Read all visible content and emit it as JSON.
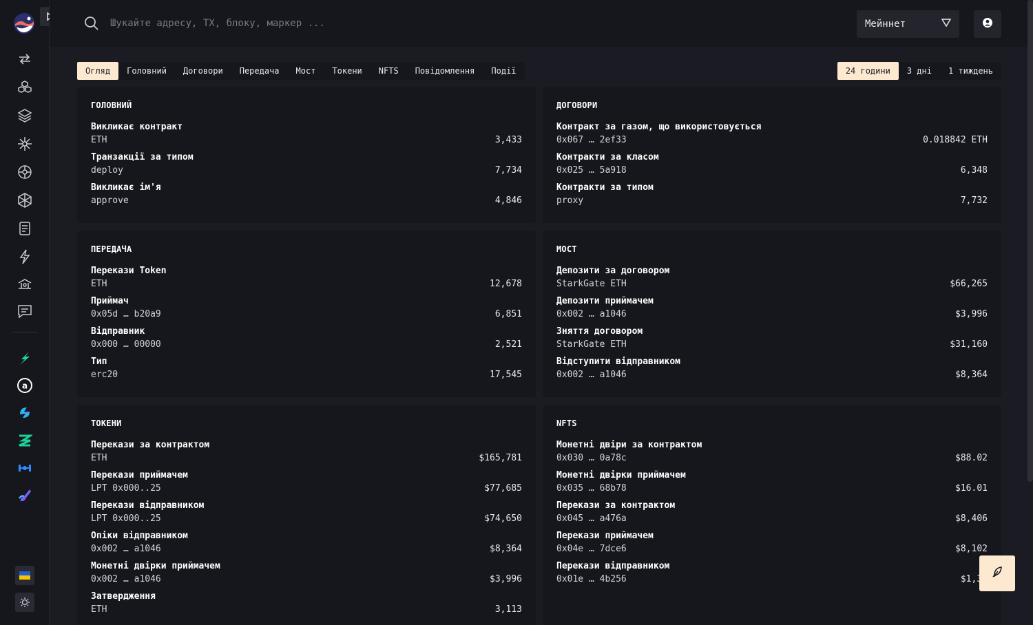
{
  "header": {
    "search_placeholder": "Шукайте адресу, TX, блоку, маркер ...",
    "network": "Мейннет"
  },
  "tabs": [
    "Огляд",
    "Головний",
    "Договори",
    "Передача",
    "Мост",
    "Токени",
    "NFTS",
    "Повідомлення",
    "Події"
  ],
  "periods": [
    "24 години",
    "3 дні",
    "1 тиждень"
  ],
  "sidebar": {
    "nav_icons": [
      "transactions-icon",
      "blocks-icon",
      "batches-icon",
      "sparkle-icon",
      "contracts-icon",
      "network-icon",
      "document-icon",
      "lightning-icon",
      "bridge-icon",
      "message-icon"
    ],
    "app_icons": [
      "starkgate-icon",
      "argent-icon",
      "layerswap-icon",
      "zksync-icon",
      "orbiter-icon",
      "jediswap-icon"
    ]
  },
  "cards": {
    "main": {
      "title": "ГОЛОВНИЙ",
      "rows": [
        {
          "label": "Викликає контракт",
          "sub": "ETH",
          "value": "3,433"
        },
        {
          "label": "Транзакції за типом",
          "sub": "deploy",
          "value": "7,734"
        },
        {
          "label": "Викликає ім'я",
          "sub": "approve",
          "value": "4,846"
        }
      ]
    },
    "contracts": {
      "title": "ДОГОВОРИ",
      "rows": [
        {
          "label": "Контракт за газом, що використовується",
          "sub": "0x067 … 2ef33",
          "value": "0.018842 ETH"
        },
        {
          "label": "Контракти за класом",
          "sub": "0x025 … 5a918",
          "value": "6,348"
        },
        {
          "label": "Контракти за типом",
          "sub": "proxy",
          "value": "7,732"
        }
      ]
    },
    "transfer": {
      "title": "ПЕРЕДАЧА",
      "rows": [
        {
          "label": "Перекази Token",
          "sub": "ETH",
          "value": "12,678"
        },
        {
          "label": "Приймач",
          "sub": "0x05d … b20a9",
          "value": "6,851"
        },
        {
          "label": "Відправник",
          "sub": "0x000 … 00000",
          "value": "2,521"
        },
        {
          "label": "Тип",
          "sub": "erc20",
          "value": "17,545"
        }
      ]
    },
    "bridge": {
      "title": "МОСТ",
      "rows": [
        {
          "label": "Депозити за договором",
          "sub": "StarkGate ETH",
          "value": "$66,265"
        },
        {
          "label": "Депозити приймачем",
          "sub": "0x002 … a1046",
          "value": "$3,996"
        },
        {
          "label": "Зняття договором",
          "sub": "StarkGate ETH",
          "value": "$31,160"
        },
        {
          "label": "Відступити відправником",
          "sub": "0x002 … a1046",
          "value": "$8,364"
        }
      ]
    },
    "tokens": {
      "title": "ТОКЕНИ",
      "rows": [
        {
          "label": "Перекази за контрактом",
          "sub": "ETH",
          "value": "$165,781"
        },
        {
          "label": "Перекази приймачем",
          "sub": "LPT 0x000..25",
          "value": "$77,685"
        },
        {
          "label": "Перекази відправником",
          "sub": "LPT 0x000..25",
          "value": "$74,650"
        },
        {
          "label": "Опіки відправником",
          "sub": "0x002 … a1046",
          "value": "$8,364"
        },
        {
          "label": "Монетні двірки приймачем",
          "sub": "0x002 … a1046",
          "value": "$3,996"
        },
        {
          "label": "Затвердження",
          "sub": "ETH",
          "value": "3,113"
        }
      ]
    },
    "nfts": {
      "title": "NFTS",
      "rows": [
        {
          "label": "Монетні двіри за контрактом",
          "sub": "0x030 … 0a78c",
          "value": "$88.02"
        },
        {
          "label": "Монетні двірки приймачем",
          "sub": "0x035 … 68b78",
          "value": "$16.01"
        },
        {
          "label": "Перекази за контрактом",
          "sub": "0x045 … a476a",
          "value": "$8,406"
        },
        {
          "label": "Перекази приймачем",
          "sub": "0x04e … 7dce6",
          "value": "$8,102"
        },
        {
          "label": "Перекази відправником",
          "sub": "0x01e … 4b256",
          "value": "$1,35"
        }
      ]
    }
  }
}
